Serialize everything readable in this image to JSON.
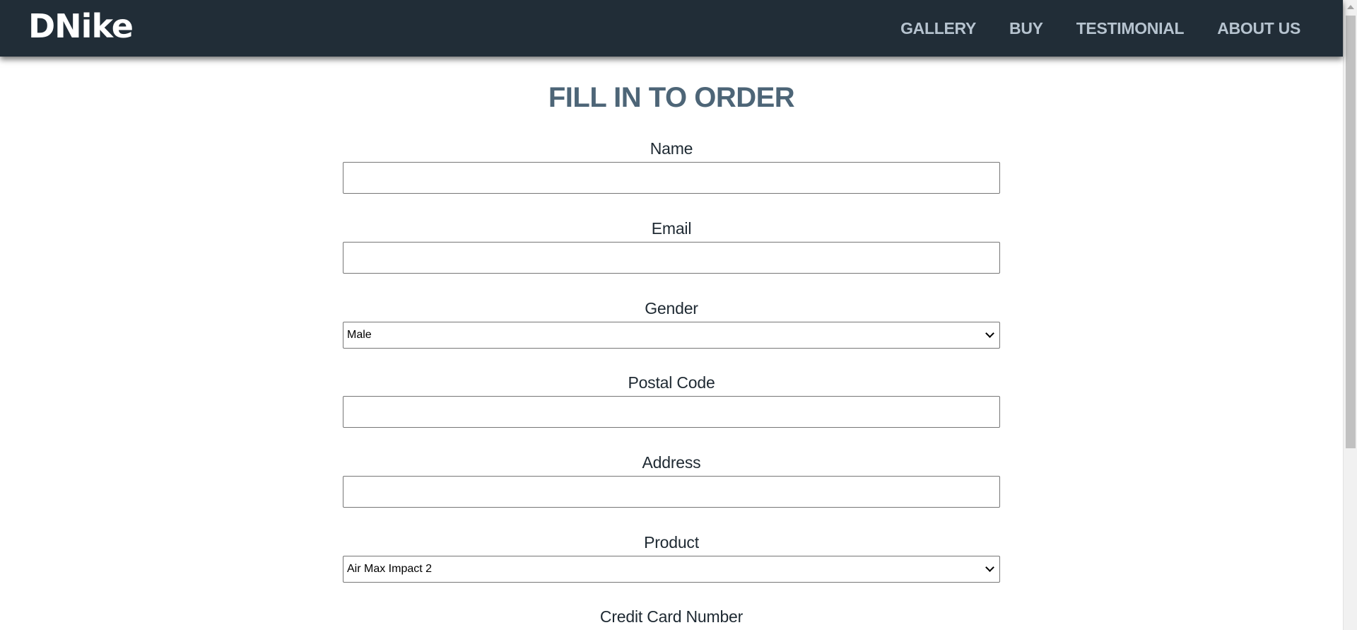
{
  "header": {
    "logo": "DNike",
    "nav": [
      "GALLERY",
      "BUY",
      "TESTIMONIAL",
      "ABOUT US"
    ]
  },
  "form": {
    "title": "FILL IN TO ORDER",
    "name_label": "Name",
    "email_label": "Email",
    "gender_label": "Gender",
    "gender_value": "Male",
    "postal_label": "Postal Code",
    "address_label": "Address",
    "product_label": "Product",
    "product_value": "Air Max Impact 2",
    "credit_label": "Credit Card Number"
  },
  "colors": {
    "navbar_bg": "#212d37",
    "nav_link": "#b6c3cf",
    "title": "#4d6577"
  }
}
